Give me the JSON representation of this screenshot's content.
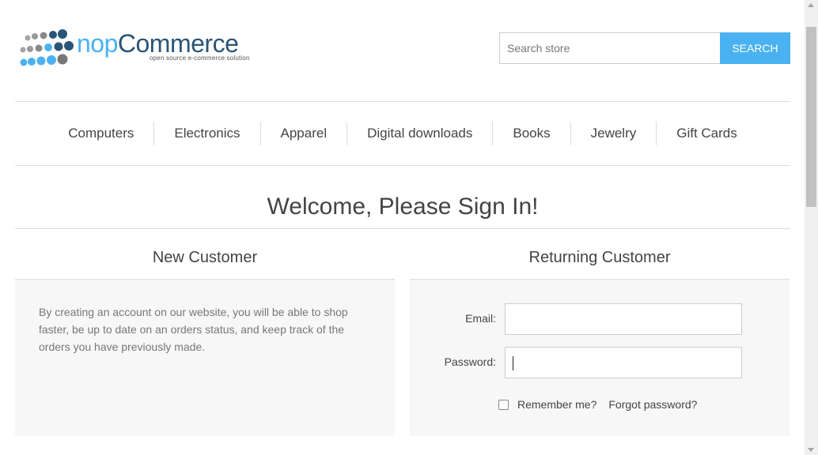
{
  "header": {
    "logo": {
      "word_a": "nop",
      "word_b": "Commerce",
      "tagline": "open source e-commerce solution"
    },
    "search": {
      "placeholder": "Search store",
      "value": "",
      "button_label": "Search"
    }
  },
  "nav": {
    "items": [
      {
        "label": "Computers"
      },
      {
        "label": "Electronics"
      },
      {
        "label": "Apparel"
      },
      {
        "label": "Digital downloads"
      },
      {
        "label": "Books"
      },
      {
        "label": "Jewelry"
      },
      {
        "label": "Gift Cards"
      }
    ]
  },
  "page": {
    "title": "Welcome, Please Sign In!",
    "new_customer": {
      "title": "New Customer",
      "text": "By creating an account on our website, you will be able to shop faster, be up to date on an orders status, and keep track of the orders you have previously made."
    },
    "returning_customer": {
      "title": "Returning Customer",
      "email_label": "Email:",
      "email_value": "",
      "password_label": "Password:",
      "password_value": "",
      "remember_label": "Remember me?",
      "remember_checked": false,
      "forgot_label": "Forgot password?"
    }
  },
  "colors": {
    "accent": "#4ab2f1",
    "brand_dark": "#2a5576",
    "panel_bg": "#f7f7f7",
    "border": "#dddddd",
    "text": "#444444",
    "muted_text": "#777777"
  }
}
